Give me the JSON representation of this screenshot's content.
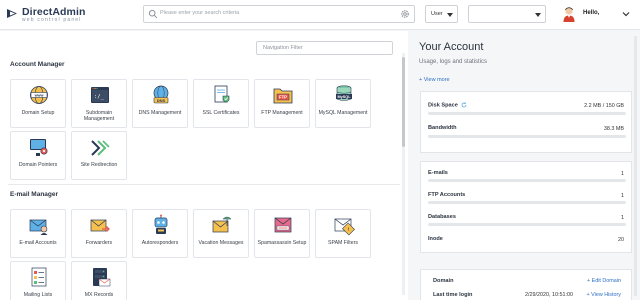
{
  "header": {
    "logo_title": "DirectAdmin",
    "logo_sub": "web control panel",
    "search_placeholder": "Please enter your search criteria",
    "user_select": "User",
    "greeting": "Hello,"
  },
  "nav_filter": {
    "placeholder": "Navigation Filter"
  },
  "account_manager": {
    "title": "Account Manager",
    "items": [
      {
        "label": "Domain Setup",
        "icon": "www-globe-icon"
      },
      {
        "label": "Subdomain Management",
        "icon": "terminal-icon"
      },
      {
        "label": "DNS Management",
        "icon": "dns-icon"
      },
      {
        "label": "SSL Certificates",
        "icon": "ssl-certificate-icon"
      },
      {
        "label": "FTP Management",
        "icon": "ftp-folder-icon"
      },
      {
        "label": "MySQL Management",
        "icon": "mysql-database-icon"
      },
      {
        "label": "Domain Pointers",
        "icon": "domain-pointer-icon"
      },
      {
        "label": "Site Redirection",
        "icon": "redirect-arrows-icon"
      }
    ]
  },
  "email_manager": {
    "title": "E-mail Manager",
    "items": [
      {
        "label": "E-mail Accounts",
        "icon": "email-account-icon"
      },
      {
        "label": "Forwarders",
        "icon": "forward-envelope-icon"
      },
      {
        "label": "Autoresponders",
        "icon": "robot-icon"
      },
      {
        "label": "Vacation Messages",
        "icon": "vacation-envelope-icon"
      },
      {
        "label": "Spamassassin Setup",
        "icon": "spam-envelope-icon"
      },
      {
        "label": "SPAM Filters",
        "icon": "spam-filter-icon"
      },
      {
        "label": "Mailing Lists",
        "icon": "mailing-list-icon"
      },
      {
        "label": "MX Records",
        "icon": "mx-records-icon"
      }
    ]
  },
  "account": {
    "title": "Your Account",
    "subtitle": "Usage, logs and statistics",
    "view_more": "+ View more",
    "disk_label": "Disk Space",
    "disk_value": "2.2 MB / 150 GB",
    "disk_fraction": 1.47e-05,
    "bandwidth_label": "Bandwidth",
    "bandwidth_value": "38.3 MB",
    "emails_label": "E-mails",
    "emails_value": "1",
    "ftp_label": "FTP Accounts",
    "ftp_value": "1",
    "db_label": "Databases",
    "db_value": "1",
    "inode_label": "Inode",
    "inode_value": "20",
    "domain_label": "Domain",
    "domain_link": "+ Edit Domain",
    "login_label": "Last time login",
    "login_value": "2/29/2020, 10:51:00",
    "history_link": "+ View History"
  },
  "colors": {
    "accent": "#2f6fc5",
    "brand": "#2a3a55"
  }
}
